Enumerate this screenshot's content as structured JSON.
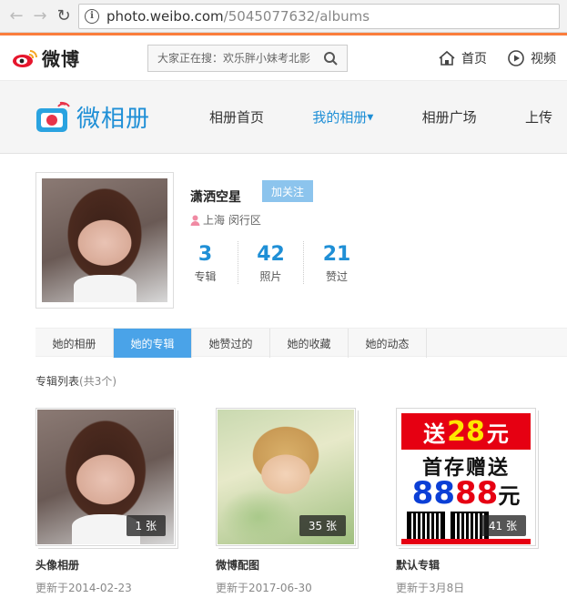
{
  "browser": {
    "url_host": "photo.weibo.com",
    "url_path": "/5045077632/albums"
  },
  "topbar": {
    "logo_text": "微博",
    "search_placeholder": "大家正在搜：欢乐胖小妹考北影",
    "links": [
      {
        "label": "首页",
        "icon": "home-icon"
      },
      {
        "label": "视频",
        "icon": "video-play-icon"
      }
    ]
  },
  "album_header": {
    "logo_text": "微相册",
    "nav": [
      {
        "label": "相册首页",
        "active": false
      },
      {
        "label": "我的相册",
        "active": true
      },
      {
        "label": "相册广场",
        "active": false
      },
      {
        "label": "上传",
        "active": false
      }
    ]
  },
  "profile": {
    "name": "潇洒空星",
    "follow_label": "加关注",
    "location": "上海 闵行区",
    "stats": [
      {
        "num": "3",
        "label": "专辑"
      },
      {
        "num": "42",
        "label": "照片"
      },
      {
        "num": "21",
        "label": "赞过"
      }
    ]
  },
  "tabs": [
    {
      "label": "她的相册",
      "active": false
    },
    {
      "label": "她的专辑",
      "active": true
    },
    {
      "label": "她赞过的",
      "active": false
    },
    {
      "label": "她的收藏",
      "active": false
    },
    {
      "label": "她的动态",
      "active": false
    }
  ],
  "album_list": {
    "title": "专辑列表",
    "count": "(共3个)",
    "albums": [
      {
        "name": "头像相册",
        "date": "更新于2014-02-23",
        "count": "1 张"
      },
      {
        "name": "微博配图",
        "date": "更新于2017-06-30",
        "count": "35 张"
      },
      {
        "name": "默认专辑",
        "date": "更新于3月8日",
        "count": "41 张"
      }
    ]
  },
  "ad": {
    "line1_a": "送",
    "line1_b": "28",
    "line1_c": "元",
    "line2": "首存赠送",
    "line3_a": "88",
    "line3_b": "88",
    "line3_c": "元"
  },
  "colors": {
    "accent_orange": "#fa7d3c",
    "weibo_blue": "#1f8fd6",
    "tab_active": "#4aa3e8",
    "follow_btn": "#8cc4ed"
  }
}
